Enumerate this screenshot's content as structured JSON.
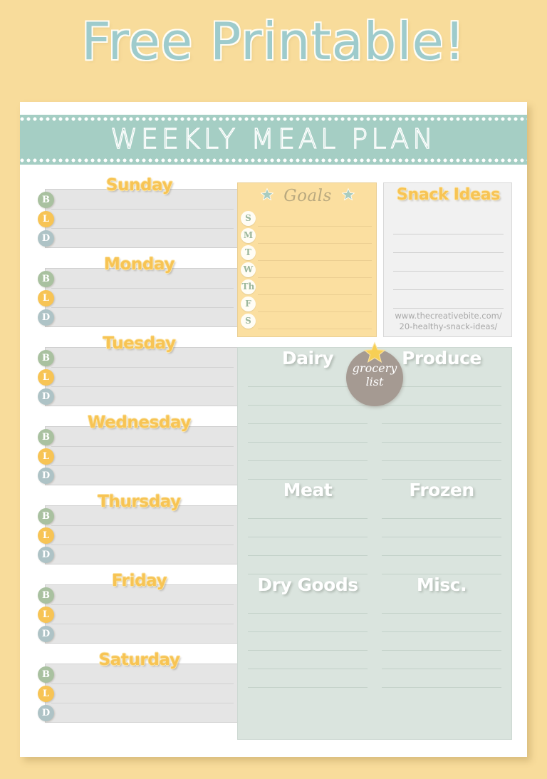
{
  "headline": "Free Printable!",
  "banner": {
    "title": "WEEKLY MEAL PLAN"
  },
  "colors": {
    "page_background": "#f8dc9b",
    "banner_teal": "#a5cec4",
    "headline_teal": "#9ecbcc",
    "day_label_gold": "#f7c455",
    "day_box_gray": "#e5e5e5",
    "goals_panel_yellow": "#fbdfa0",
    "snack_panel_gray": "#f1f1f1",
    "grocery_panel_sage": "#dae4de",
    "grocery_badge_taupe": "#a59a92",
    "badge_breakfast_green": "#a9c1a0",
    "badge_lunch_yellow": "#f7c455",
    "badge_dinner_blue": "#aec3c6"
  },
  "days": [
    {
      "name": "Sunday",
      "meals": [
        {
          "code": "B",
          "type": "breakfast"
        },
        {
          "code": "L",
          "type": "lunch"
        },
        {
          "code": "D",
          "type": "dinner"
        }
      ]
    },
    {
      "name": "Monday",
      "meals": [
        {
          "code": "B",
          "type": "breakfast"
        },
        {
          "code": "L",
          "type": "lunch"
        },
        {
          "code": "D",
          "type": "dinner"
        }
      ]
    },
    {
      "name": "Tuesday",
      "meals": [
        {
          "code": "B",
          "type": "breakfast"
        },
        {
          "code": "L",
          "type": "lunch"
        },
        {
          "code": "D",
          "type": "dinner"
        }
      ]
    },
    {
      "name": "Wednesday",
      "meals": [
        {
          "code": "B",
          "type": "breakfast"
        },
        {
          "code": "L",
          "type": "lunch"
        },
        {
          "code": "D",
          "type": "dinner"
        }
      ]
    },
    {
      "name": "Thursday",
      "meals": [
        {
          "code": "B",
          "type": "breakfast"
        },
        {
          "code": "L",
          "type": "lunch"
        },
        {
          "code": "D",
          "type": "dinner"
        }
      ]
    },
    {
      "name": "Friday",
      "meals": [
        {
          "code": "B",
          "type": "breakfast"
        },
        {
          "code": "L",
          "type": "lunch"
        },
        {
          "code": "D",
          "type": "dinner"
        }
      ]
    },
    {
      "name": "Saturday",
      "meals": [
        {
          "code": "B",
          "type": "breakfast"
        },
        {
          "code": "L",
          "type": "lunch"
        },
        {
          "code": "D",
          "type": "dinner"
        }
      ]
    }
  ],
  "goals": {
    "title": "Goals",
    "star_icon": "star-icon",
    "day_letters": [
      "S",
      "M",
      "T",
      "W",
      "Th",
      "F",
      "S"
    ]
  },
  "snacks": {
    "title": "Snack Ideas",
    "line_count": 5,
    "url_line_1": "www.thecreativebite.com/",
    "url_line_2": "20-healthy-snack-ideas/"
  },
  "grocery": {
    "badge_line_1": "grocery",
    "badge_line_2": "list",
    "badge_star_icon": "star-icon",
    "left_sections": [
      {
        "title": "Dairy",
        "lines": 6
      },
      {
        "title": "Meat",
        "lines": 4
      },
      {
        "title": "Dry Goods",
        "lines": 5
      }
    ],
    "right_sections": [
      {
        "title": "Produce",
        "lines": 6
      },
      {
        "title": "Frozen",
        "lines": 4
      },
      {
        "title": "Misc.",
        "lines": 5
      }
    ]
  }
}
